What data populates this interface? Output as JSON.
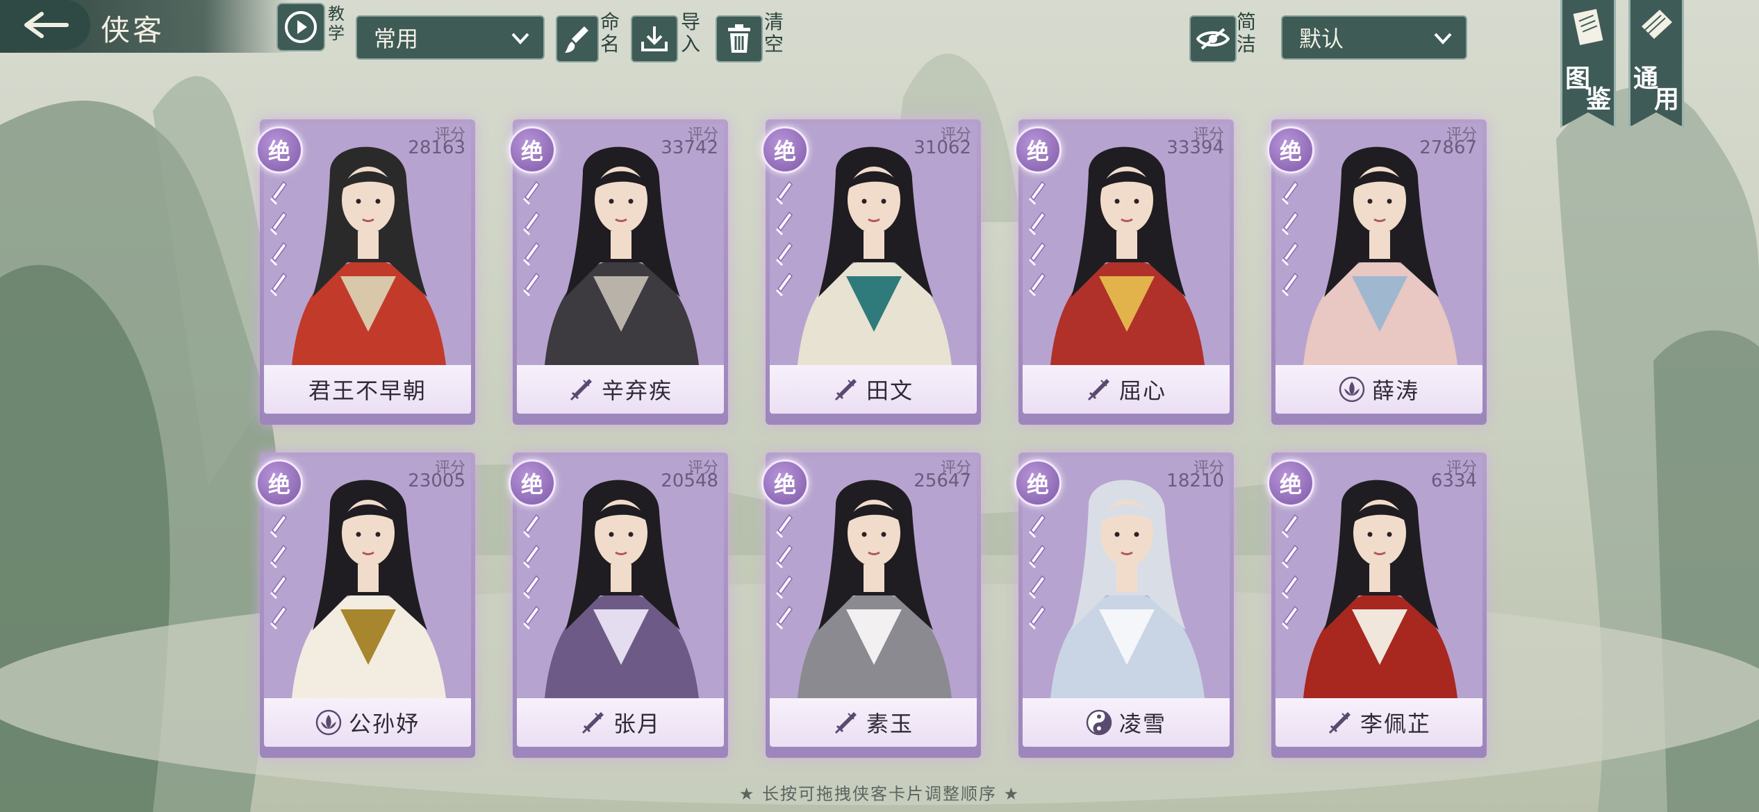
{
  "header": {
    "title": "侠客",
    "tutorial_label": "教学",
    "preset_select": "常用",
    "rename_label": "命名",
    "import_label": "导入",
    "clear_label": "清空",
    "simple_label": "简洁",
    "sort_select": "默认"
  },
  "side_banners": [
    {
      "label": "图鉴",
      "icon": "book-icon"
    },
    {
      "label": "通用",
      "icon": "scroll-icon"
    }
  ],
  "score_label": "评分",
  "rank_label": "绝",
  "cards": [
    {
      "name": "君王不早朝",
      "score": "28163",
      "type_icon": ""
    },
    {
      "name": "辛弃疾",
      "score": "33742",
      "type_icon": "sword-icon"
    },
    {
      "name": "田文",
      "score": "31062",
      "type_icon": "sword-icon"
    },
    {
      "name": "屈心",
      "score": "33394",
      "type_icon": "sword-icon"
    },
    {
      "name": "薛涛",
      "score": "27867",
      "type_icon": "lotus-icon"
    },
    {
      "name": "公孙妤",
      "score": "23005",
      "type_icon": "lotus-icon"
    },
    {
      "name": "张月",
      "score": "20548",
      "type_icon": "sword-icon"
    },
    {
      "name": "素玉",
      "score": "25647",
      "type_icon": "sword-icon"
    },
    {
      "name": "凌雪",
      "score": "18210",
      "type_icon": "yinyang-icon"
    },
    {
      "name": "李佩芷",
      "score": "6334",
      "type_icon": "sword-icon"
    }
  ],
  "footer_hint": "★ 长按可拖拽侠客卡片调整顺序 ★",
  "colors": {
    "card_purple": "#a68ec2",
    "button_teal": "#3e5b55",
    "background": "#c9cfbf"
  }
}
